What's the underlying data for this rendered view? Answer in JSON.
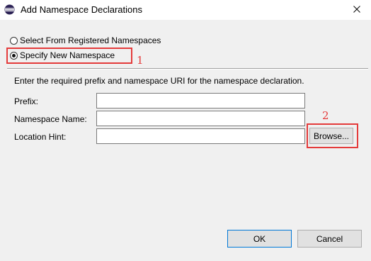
{
  "window": {
    "title": "Add Namespace Declarations",
    "close_glyph": "✕"
  },
  "options": {
    "registered_label": "Select From Registered Namespaces",
    "registered_checked": false,
    "new_label": "Specify New Namespace",
    "new_checked": true
  },
  "annotations": {
    "one": "1",
    "two": "2",
    "color": "#e43b3b"
  },
  "form": {
    "instructions": "Enter the required prefix and namespace URI for the namespace declaration.",
    "prefix_label": "Prefix:",
    "prefix_value": "",
    "namespace_label": "Namespace Name:",
    "namespace_value": "",
    "location_label": "Location Hint:",
    "location_value": "",
    "browse_label": "Browse..."
  },
  "footer": {
    "ok_label": "OK",
    "cancel_label": "Cancel"
  },
  "icons": {
    "app": "eclipse-icon",
    "close": "close-icon"
  }
}
